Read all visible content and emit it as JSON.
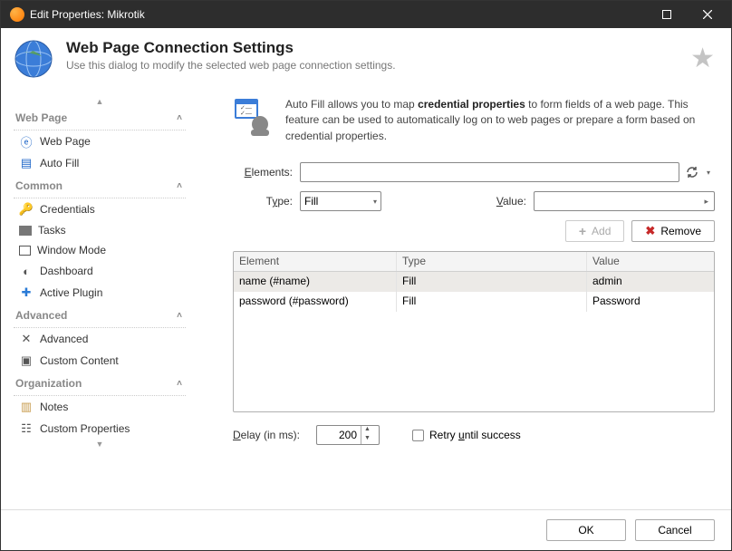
{
  "window": {
    "title": "Edit Properties: Mikrotik"
  },
  "header": {
    "title": "Web Page Connection Settings",
    "sub": "Use this dialog to modify the selected web page connection settings."
  },
  "sidebar": {
    "groups": {
      "web_page": {
        "label": "Web Page"
      },
      "common": {
        "label": "Common"
      },
      "advanced": {
        "label": "Advanced"
      },
      "organization": {
        "label": "Organization"
      }
    },
    "items": {
      "web_page": "Web Page",
      "auto_fill": "Auto Fill",
      "credentials": "Credentials",
      "tasks": "Tasks",
      "window_mode": "Window Mode",
      "dashboard": "Dashboard",
      "active_plugin": "Active Plugin",
      "advanced": "Advanced",
      "custom_content": "Custom Content",
      "notes": "Notes",
      "custom_properties": "Custom Properties"
    }
  },
  "intro": {
    "before": "Auto Fill allows you to map ",
    "bold": "credential properties",
    "after": " to form fields of a web page. This feature can be used to automatically log on to web pages or prepare a form based on credential properties."
  },
  "form": {
    "elements_label": "Elements:",
    "type_label": "Type:",
    "type_value": "Fill",
    "value_label": "Value:"
  },
  "buttons": {
    "add": "Add",
    "remove": "Remove",
    "ok": "OK",
    "cancel": "Cancel"
  },
  "table": {
    "cols": {
      "element": "Element",
      "type": "Type",
      "value": "Value"
    },
    "rows": [
      {
        "element": "name (#name)",
        "type": "Fill",
        "value": "admin"
      },
      {
        "element": "password (#password)",
        "type": "Fill",
        "value": "Password"
      }
    ]
  },
  "delay": {
    "label": "Delay (in ms):",
    "value": "200"
  },
  "retry": {
    "label": "Retry until success"
  }
}
